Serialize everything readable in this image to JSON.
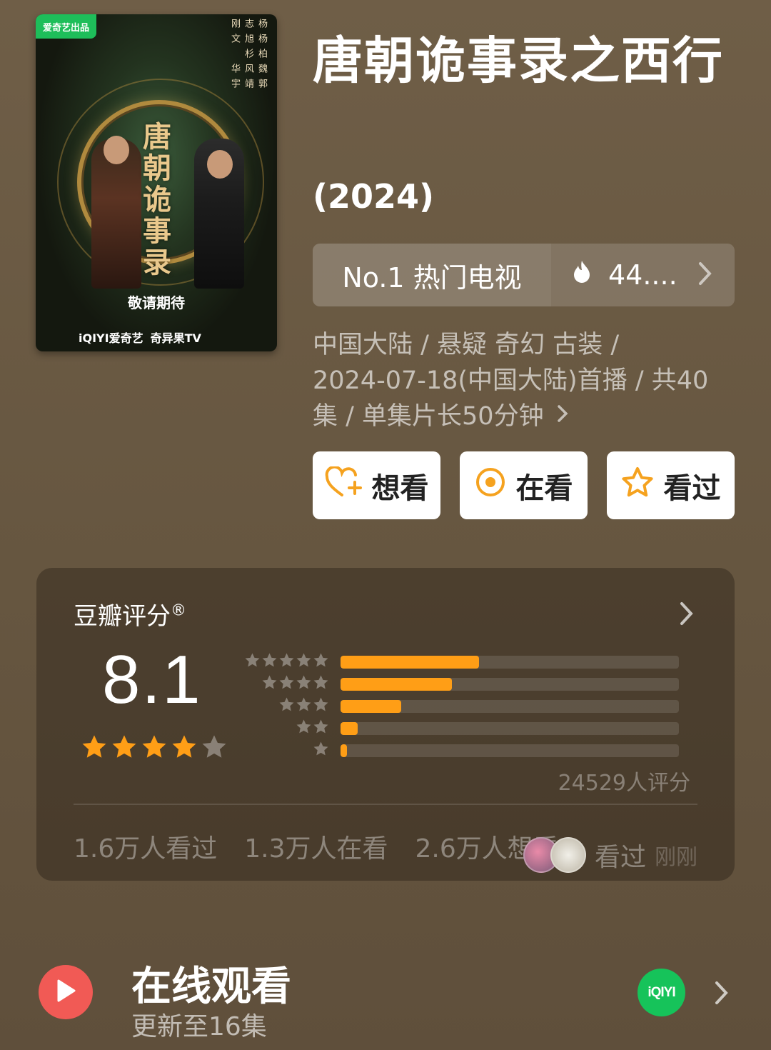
{
  "poster": {
    "badge": "爱奇艺出品",
    "cast": [
      "杨志刚",
      "杨旭文",
      "柏杉",
      "魏风华",
      "郭靖宇"
    ],
    "calligraphy": "唐朝诡事录",
    "tagline": "敬请期待",
    "platforms": [
      "iQIYI爱奇艺",
      "奇异果TV"
    ]
  },
  "title": "唐朝诡事录之西行",
  "year": "(2024)",
  "rank": {
    "label": "No.1 热门电视",
    "heat": "44....",
    "icon": "flame-icon"
  },
  "meta": {
    "line1": "中国大陆 / 悬疑 奇幻 古装 /",
    "line2": "2024-07-18(中国大陆)首播 / 共40",
    "line3": "集 / 单集片长50分钟"
  },
  "actions": {
    "want": "想看",
    "watching": "在看",
    "watched": "看过"
  },
  "rating": {
    "label": "豆瓣评分",
    "mark": "®",
    "score": "8.1",
    "stars": 4,
    "distribution": [
      {
        "stars": 5,
        "fraction": 0.41
      },
      {
        "stars": 4,
        "fraction": 0.33
      },
      {
        "stars": 3,
        "fraction": 0.18
      },
      {
        "stars": 2,
        "fraction": 0.05
      },
      {
        "stars": 1,
        "fraction": 0.02
      }
    ],
    "count": "24529人评分",
    "stats": {
      "watched": "1.6万人看过",
      "watching": "1.3万人在看",
      "want": "2.6万人想看"
    },
    "recent": {
      "action": "看过",
      "time": "刚刚"
    }
  },
  "watch": {
    "title": "在线观看",
    "subtitle": "更新至16集",
    "provider": "iQIYI"
  },
  "colors": {
    "accent": "#ff9e16",
    "background": "#6b5b45",
    "play": "#f15a55",
    "iqiyi": "#16c35a"
  }
}
